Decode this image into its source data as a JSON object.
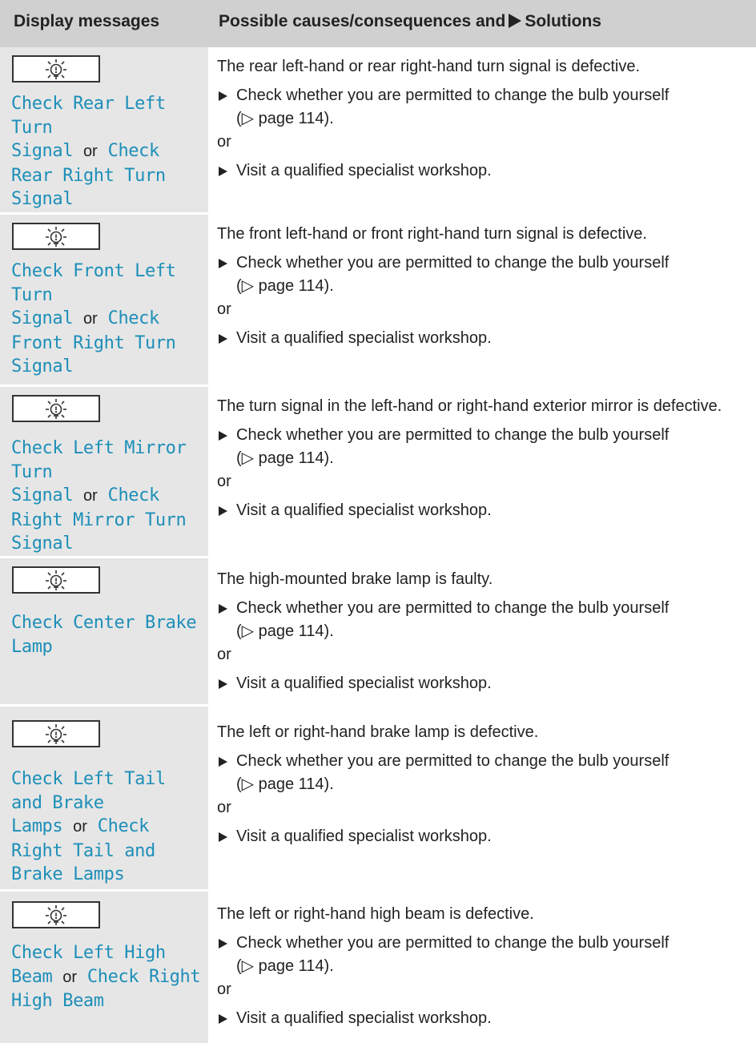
{
  "header": {
    "col1": "Display messages",
    "col2_pre": "Possible causes/consequences and",
    "col2_post": "Solutions"
  },
  "common": {
    "check_bulb": "Check whether you are permitted to change the bulb yourself",
    "page_ref": "(▷ page 114).",
    "or": "or",
    "visit": "Visit a qualified specialist workshop."
  },
  "rows": [
    {
      "msg_a": "Check Rear Left\nTurn\nSignal",
      "or": "or",
      "msg_b": "Check\nRear Right Turn\nSignal",
      "cause": "The rear left-hand or rear right-hand turn signal is defective."
    },
    {
      "msg_a": "Check Front Left\nTurn\nSignal",
      "or": "or",
      "msg_b": "Check\nFront Right Turn\nSignal",
      "cause": "The front left-hand or front right-hand turn signal is defective."
    },
    {
      "msg_a": "Check Left Mirror\nTurn\nSignal",
      "or": "or",
      "msg_b": "Check\nRight Mirror Turn\nSignal",
      "cause": "The turn signal in the left-hand or right-hand exterior mirror is defective."
    },
    {
      "msg_a": "Check Center Brake\nLamp",
      "or": "",
      "msg_b": "",
      "cause": "The high-mounted brake lamp is faulty."
    },
    {
      "msg_a": "Check Left Tail\nand Brake\nLamps",
      "or": "or",
      "msg_b": "Check\nRight Tail and\nBrake Lamps",
      "cause": "The left or right-hand brake lamp is defective."
    },
    {
      "msg_a": "Check Left High\nBeam",
      "or": "or",
      "msg_b": "Check Right\nHigh Beam",
      "cause": "The left or right-hand high beam is defective."
    }
  ],
  "icon": "bulb-warning-icon",
  "colors": {
    "message": "#1d8fb8",
    "header_bg": "#d0d0d0",
    "left_bg": "#e6e6e6"
  }
}
